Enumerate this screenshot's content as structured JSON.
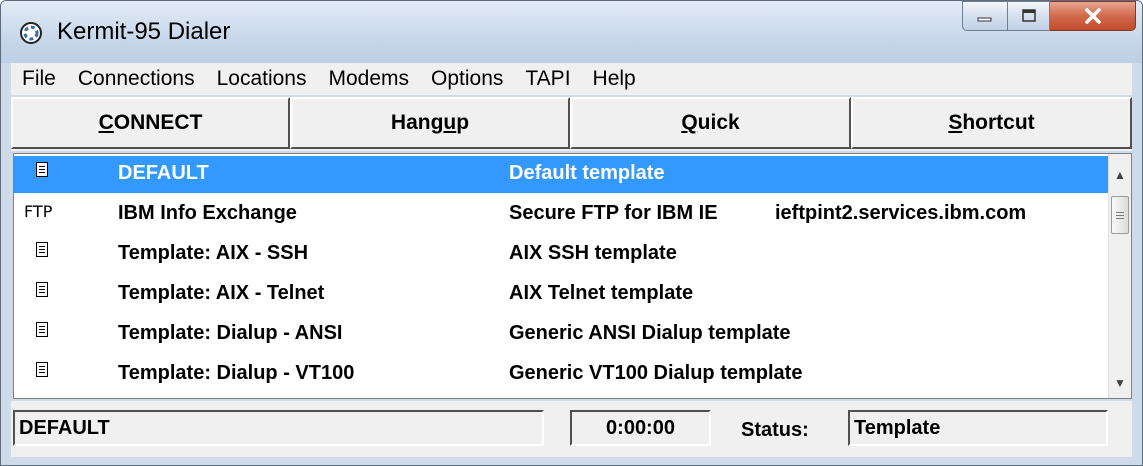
{
  "window": {
    "title": "Kermit-95 Dialer"
  },
  "menu": [
    "File",
    "Connections",
    "Locations",
    "Modems",
    "Options",
    "TAPI",
    "Help"
  ],
  "toolbar": {
    "connect": {
      "u": "C",
      "rest": "ONNECT"
    },
    "hangup": {
      "pre": "Hang",
      "u": "u",
      "rest": "p"
    },
    "quick": {
      "u": "Q",
      "rest": "uick"
    },
    "shortcut": {
      "u": "S",
      "rest": "hortcut"
    }
  },
  "entries": [
    {
      "icon": "doc-icon",
      "icon_text": "",
      "name": "DEFAULT",
      "description": "Default template",
      "host": "",
      "selected": true
    },
    {
      "icon": "ftp-icon",
      "icon_text": "FTP",
      "name": "IBM Info Exchange",
      "description": "Secure FTP for IBM IE",
      "host": "ieftpint2.services.ibm.com",
      "selected": false
    },
    {
      "icon": "doc-icon",
      "icon_text": "",
      "name": "Template: AIX - SSH",
      "description": "AIX SSH template",
      "host": "",
      "selected": false
    },
    {
      "icon": "doc-icon",
      "icon_text": "",
      "name": "Template: AIX - Telnet",
      "description": "AIX Telnet template",
      "host": "",
      "selected": false
    },
    {
      "icon": "doc-icon",
      "icon_text": "",
      "name": "Template: Dialup - ANSI",
      "description": "Generic ANSI Dialup template",
      "host": "",
      "selected": false
    },
    {
      "icon": "doc-icon",
      "icon_text": "",
      "name": "Template: Dialup - VT100",
      "description": "Generic VT100 Dialup template",
      "host": "",
      "selected": false
    }
  ],
  "statusbar": {
    "entry": "DEFAULT",
    "timer": "0:00:00",
    "status_label": "Status:",
    "status_value": "Template"
  },
  "colors": {
    "selection": "#3399ff",
    "close_button": "#c8553a"
  }
}
